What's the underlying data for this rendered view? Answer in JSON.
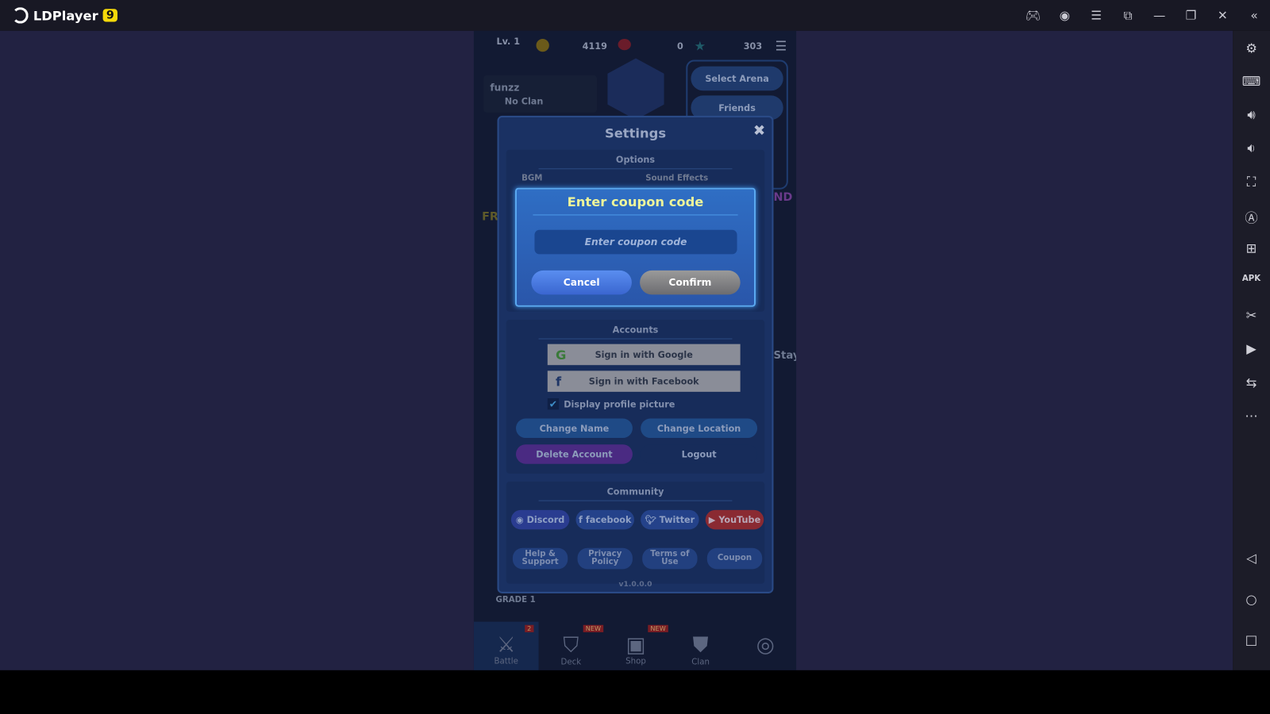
{
  "window": {
    "app_name": "LDPlayer",
    "version_badge": "9",
    "controls": [
      "gamepad-icon",
      "account-icon",
      "menu-icon",
      "sync-icon",
      "minimize-icon",
      "restore-icon",
      "close-icon"
    ]
  },
  "sidebar": {
    "icons": [
      "settings-icon",
      "keyboard-icon",
      "volume-up-icon",
      "volume-down-icon",
      "screenshot-icon",
      "auto-icon",
      "add-window-icon",
      "apk-icon",
      "scissors-icon",
      "record-icon",
      "sync-files-icon",
      "more-icon",
      "back-icon",
      "home-icon",
      "recents-icon"
    ]
  },
  "game": {
    "hud": {
      "level": "Lv. 1",
      "gold": "4119",
      "gems": "0",
      "stars": "303"
    },
    "profile": {
      "name": "funzz",
      "clan": "No Clan"
    },
    "menu": {
      "select_arena": "Select Arena",
      "friends": "Friends"
    },
    "grade": "GRADE 1",
    "bg_text": {
      "left": "FR",
      "right": "ND",
      "stay": "Stay"
    },
    "nav": [
      {
        "label": "Battle",
        "badge": "2"
      },
      {
        "label": "Deck",
        "badge": "NEW"
      },
      {
        "label": "Shop",
        "badge": "NEW"
      },
      {
        "label": "Clan",
        "badge": ""
      },
      {
        "label": "",
        "badge": ""
      }
    ]
  },
  "settings": {
    "title": "Settings",
    "options": {
      "heading": "Options",
      "bgm": "BGM",
      "sfx": "Sound Effects"
    },
    "coupon_dialog": {
      "title": "Enter coupon code",
      "placeholder": "Enter coupon code",
      "value": "",
      "cancel": "Cancel",
      "confirm": "Confirm"
    },
    "accounts": {
      "heading": "Accounts",
      "google": "Sign in with Google",
      "facebook": "Sign in with Facebook",
      "display_picture": "Display profile picture",
      "display_picture_checked": true,
      "change_name": "Change Name",
      "change_location": "Change Location",
      "delete_account": "Delete Account",
      "logout": "Logout"
    },
    "community": {
      "heading": "Community",
      "discord": "Discord",
      "facebook": "facebook",
      "twitter": "Twitter",
      "youtube": "YouTube",
      "help": "Help & Support",
      "privacy": "Privacy Policy",
      "terms": "Terms of Use",
      "coupon": "Coupon"
    },
    "version": "v1.0.0.0"
  },
  "colors": {
    "coupon_title": "#eef59a",
    "youtube": "#c0302f",
    "delete": "#6a2f9a"
  }
}
